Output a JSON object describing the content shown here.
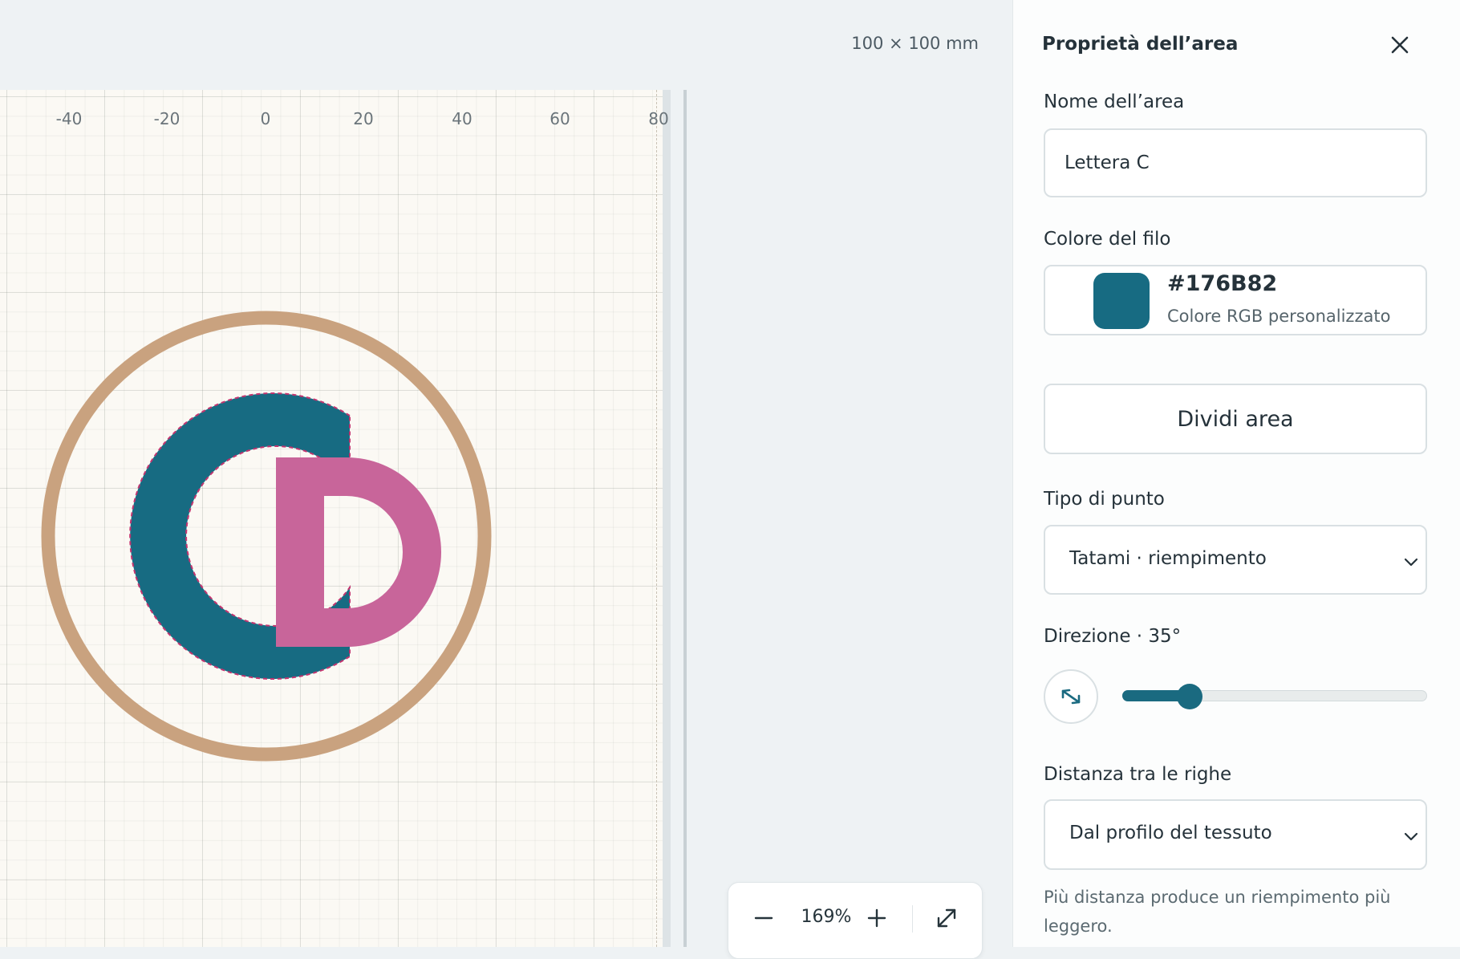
{
  "canvas": {
    "dimensions": "100 × 100 mm",
    "ruler_ticks": [
      "-40",
      "-20",
      "0",
      "20",
      "40",
      "60",
      "80"
    ],
    "design_colors": {
      "ring": "#c9a27f",
      "letter_c": "#176B82",
      "letter_d": "#c8659a",
      "selection_outline": "#c2356f"
    }
  },
  "zoom": {
    "value": "169%",
    "zoom_out_icon": "minus-icon",
    "zoom_in_icon": "plus-icon",
    "fit_icon": "expand-icon"
  },
  "panel": {
    "title": "Proprietà dell’area",
    "close_icon": "close-icon",
    "name_label": "Nome dell’area",
    "name_value": "Lettera C",
    "color_label": "Colore del filo",
    "color_hex": "#176B82",
    "color_description": "Colore RGB personalizzato",
    "split_button": "Dividi area",
    "stitch_type_label": "Tipo di punto",
    "stitch_type_value": "Tatami · riempimento",
    "direction_label": "Direzione · 35°",
    "direction_fraction": 0.22,
    "direction_icon": "diagonal-arrows-icon",
    "row_spacing_label": "Distanza tra le righe",
    "row_spacing_value": "Dal profilo del tessuto",
    "hint": "Più distanza produce un riempimento più leggero.",
    "accent": "#1a6a80"
  }
}
